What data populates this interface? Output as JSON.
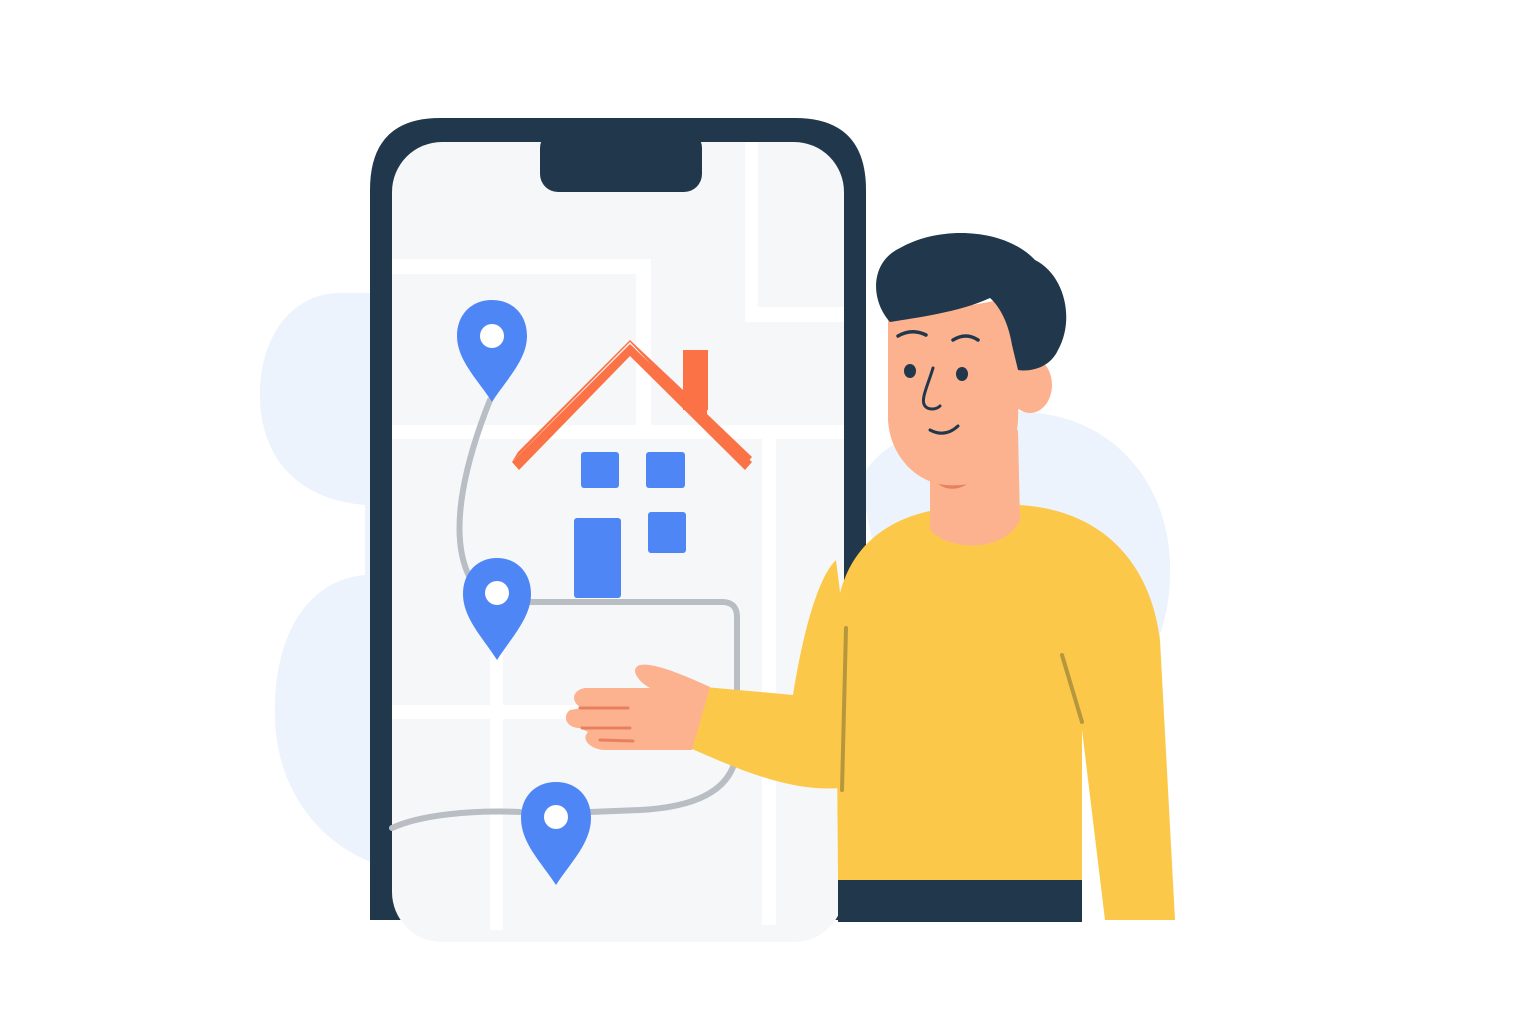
{
  "illustration": {
    "subject": "",
    "colors": {
      "background": "#ffffff",
      "blob": "#edf3fd",
      "phone_frame": "#21384c",
      "screen": "#f6f7f9",
      "road": "#ffffff",
      "route": "#b9bec5",
      "pin": "#4f86f6",
      "pin_dot": "#ffffff",
      "roof": "#fc7247",
      "house_window": "#4f86f6",
      "hair": "#21384c",
      "skin": "#fcb28f",
      "skin_shadow": "#e8805f",
      "sweater": "#fcc84a",
      "sweater_seam": "#b7973e",
      "pants": "#21384c"
    },
    "icons": [
      "location-pin-icon",
      "house-icon"
    ]
  }
}
